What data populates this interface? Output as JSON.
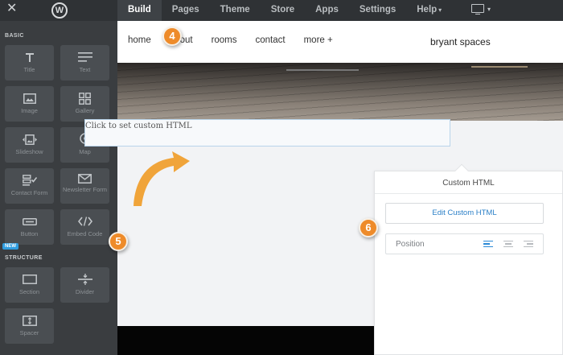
{
  "topbar": {
    "close_glyph": "✕",
    "logo_glyph": "W",
    "nav": [
      {
        "label": "Build",
        "active": true
      },
      {
        "label": "Pages"
      },
      {
        "label": "Theme"
      },
      {
        "label": "Store"
      },
      {
        "label": "Apps"
      },
      {
        "label": "Settings"
      },
      {
        "label": "Help"
      }
    ],
    "help_caret": "▾",
    "device_icon": "monitor-icon",
    "device_caret": "▾"
  },
  "sidebar": {
    "basic_label": "BASIC",
    "structure_label": "STRUCTURE",
    "new_badge": "NEW",
    "basic_items": [
      {
        "label": "Title",
        "icon": "title-T-icon"
      },
      {
        "label": "Text",
        "icon": "text-lines-icon"
      },
      {
        "label": "Image",
        "icon": "image-icon"
      },
      {
        "label": "Gallery",
        "icon": "gallery-grid-icon"
      },
      {
        "label": "Slideshow",
        "icon": "slideshow-icon"
      },
      {
        "label": "Map",
        "icon": "map-pin-icon"
      },
      {
        "label": "Contact Form",
        "icon": "contact-form-icon"
      },
      {
        "label": "Newsletter Form",
        "icon": "envelope-icon"
      },
      {
        "label": "Button",
        "icon": "button-icon"
      },
      {
        "label": "Embed Code",
        "icon": "code-brackets-icon"
      }
    ],
    "structure_items": [
      {
        "label": "Section",
        "icon": "section-icon"
      },
      {
        "label": "Divider",
        "icon": "divider-icon"
      },
      {
        "label": "Spacer",
        "icon": "spacer-icon"
      }
    ]
  },
  "site": {
    "nav": [
      "home",
      "about",
      "rooms",
      "contact",
      "more  +"
    ],
    "brand": "bryant spaces",
    "html_placeholder": "Click to set custom HTML"
  },
  "popover": {
    "title": "Custom HTML",
    "edit_button": "Edit Custom HTML",
    "position_label": "Position",
    "position_selected": "left"
  },
  "steps": {
    "s4": "4",
    "s5": "5",
    "s6": "6"
  },
  "colors": {
    "step_marker": "#ee8b2a",
    "accent_blue": "#2a7fc7"
  }
}
